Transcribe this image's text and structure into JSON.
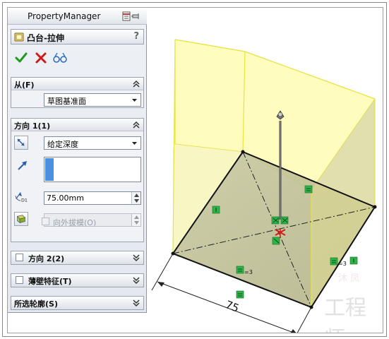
{
  "panel": {
    "header_title": "PropertyManager",
    "feature_name": "凸台-拉伸",
    "help_label": "?",
    "actions": {
      "ok_icon": "check-icon",
      "cancel_icon": "x-icon",
      "preview_icon": "glasses-icon"
    },
    "from_group": {
      "title": "从(F)",
      "start_condition": "草图基准面"
    },
    "direction1_group": {
      "title": "方向 1(1)",
      "end_condition": "给定深度",
      "depth_label": "D1",
      "depth_value": "75.00mm",
      "draft_outward_label": "向外拔模(O)"
    },
    "direction2_group": {
      "title": "方向 2(2)"
    },
    "thin_feature_group": {
      "title": "薄壁特征(T)"
    },
    "selected_contours_group": {
      "title": "所选轮廓(S)"
    }
  },
  "viewport": {
    "dimension_text": "75",
    "relation_marks": [
      "=3",
      "=3",
      "I",
      "I",
      "="
    ],
    "watermark_text": "工程师",
    "watermark_small": "沐 凤",
    "colors": {
      "extrude_preview": "#fffe9c",
      "extrude_edge": "#e7e342",
      "sketch_relation": "#2fb34a"
    }
  }
}
